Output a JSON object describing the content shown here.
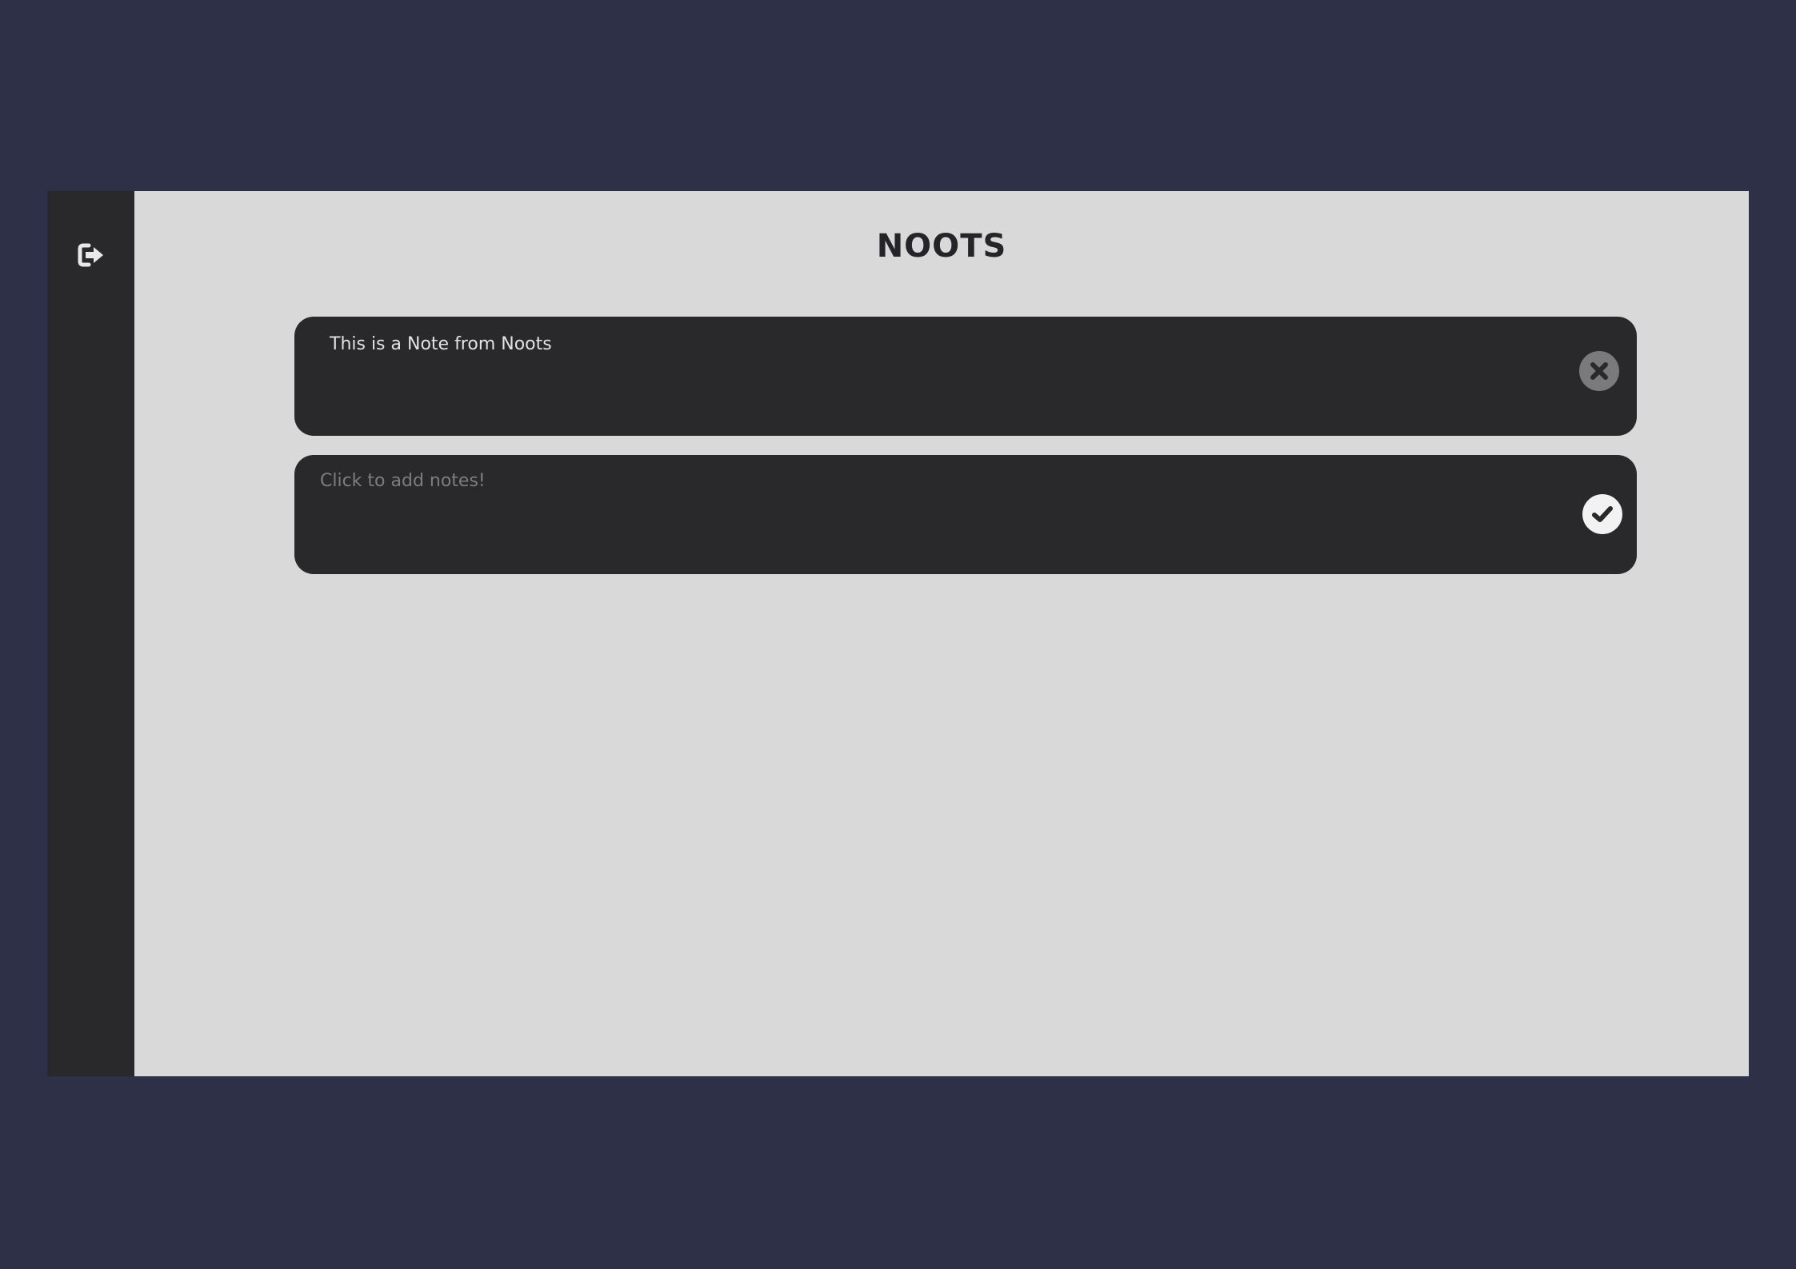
{
  "header": {
    "title": "NOOTS"
  },
  "sidebar": {
    "logout_icon": "sign-out-icon"
  },
  "notes": [
    {
      "text": "This is a Note from Noots",
      "action_icon": "close-icon"
    }
  ],
  "new_note": {
    "placeholder": "Click to add notes!",
    "value": "",
    "action_icon": "check-icon"
  },
  "colors": {
    "page_background": "#2e3048",
    "sidebar": "#29292b",
    "main_background": "#d9d9d9",
    "card": "#29292b",
    "title": "#252529",
    "delete_button": "#7a7a7c",
    "save_button": "#f2f2f2"
  }
}
